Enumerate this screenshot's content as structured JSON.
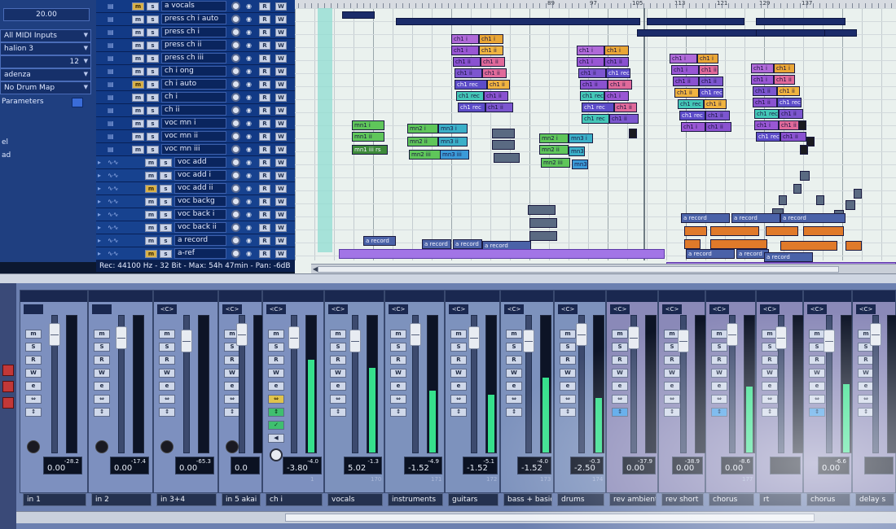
{
  "inspector": {
    "display_value": "20.00",
    "midi_input": "All MIDI Inputs",
    "channel_name": "halion 3",
    "channel_value": "12",
    "cadenza": "adenza",
    "drum_map": "No Drum Map",
    "parameters": "Parameters",
    "frag1": "el",
    "frag2": "ad"
  },
  "tracks": [
    {
      "name": "a vocals",
      "type": "midi"
    },
    {
      "name": "press ch i auto",
      "type": "midi"
    },
    {
      "name": "press ch i",
      "type": "midi"
    },
    {
      "name": "press ch ii",
      "type": "midi"
    },
    {
      "name": "press ch iii",
      "type": "midi"
    },
    {
      "name": "ch i ong",
      "type": "midi"
    },
    {
      "name": "ch i auto",
      "type": "midi"
    },
    {
      "name": "ch i",
      "type": "midi"
    },
    {
      "name": "ch ii",
      "type": "midi"
    },
    {
      "name": "voc mn i",
      "type": "midi"
    },
    {
      "name": "voc mn ii",
      "type": "midi"
    },
    {
      "name": "voc mn iii",
      "type": "midi"
    },
    {
      "name": "voc add",
      "type": "audio"
    },
    {
      "name": "voc add i",
      "type": "audio"
    },
    {
      "name": "voc add ii",
      "type": "audio"
    },
    {
      "name": "voc backg",
      "type": "audio"
    },
    {
      "name": "voc back i",
      "type": "audio"
    },
    {
      "name": "voc back ii",
      "type": "audio"
    },
    {
      "name": "a record",
      "type": "audio"
    },
    {
      "name": "a-ref",
      "type": "audio"
    }
  ],
  "track_button_labels": {
    "mute": "m",
    "solo": "s",
    "read": "R",
    "write": "W"
  },
  "status": "Rec: 44100 Hz - 32 Bit - Max: 54h 47min - Pan: -6dB",
  "ruler_ticks": [
    "89",
    "97",
    "105",
    "113",
    "121",
    "129",
    "137"
  ],
  "clips": [
    {
      "label": "ch1 i",
      "color": "#b06ad8"
    },
    {
      "label": "ch1 i",
      "color": "#e9a636"
    },
    {
      "label": "ch1 i",
      "color": "#9957d4"
    },
    {
      "label": "ch1 ii",
      "color": "#f0b440"
    },
    {
      "label": "ch1 ii",
      "color": "#8a52d0"
    },
    {
      "label": "ch1 ii",
      "color": "#e06a9a"
    },
    {
      "label": "ch1 ii",
      "color": "#7c56cf"
    },
    {
      "label": "ch1 rec",
      "color": "#44c8b8"
    },
    {
      "label": "ch1 rec",
      "color": "#5c4cc8"
    },
    {
      "label": "mn1 i",
      "color": "#5fc65a"
    },
    {
      "label": "mn1 ii",
      "color": "#5fc65a"
    },
    {
      "label": "mn1 iii rs",
      "color": "#3d8a3a"
    },
    {
      "label": "mn2 i",
      "color": "#5fc65a"
    },
    {
      "label": "mn3 i",
      "color": "#3bb0c8"
    },
    {
      "label": "mn2 ii",
      "color": "#5fc65a"
    },
    {
      "label": "mn3 ii",
      "color": "#3bb0c8"
    },
    {
      "label": "mn2 iii",
      "color": "#5fc65a"
    },
    {
      "label": "mn3 iii",
      "color": "#3b9ad8"
    },
    {
      "label": "a record",
      "color": "#4a62a8"
    },
    {
      "label": "a record",
      "color": "#4a62a8"
    },
    {
      "label": "a record",
      "color": "#4a62a8"
    }
  ],
  "mixer_channels": [
    {
      "name": "in 1",
      "pan": "",
      "volume": "0.00",
      "peak": "-28.2",
      "number": "",
      "meter": 0.0,
      "type": "input"
    },
    {
      "name": "in 2",
      "pan": "",
      "volume": "0.00",
      "peak": "-17.4",
      "number": "",
      "meter": 0.0,
      "type": "input"
    },
    {
      "name": "in 3+4",
      "pan": "<C>",
      "volume": "0.00",
      "peak": "-65.3",
      "number": "",
      "meter": 0.0,
      "type": "input"
    },
    {
      "name": "in 5 akai",
      "pan": "<C>",
      "volume": "0.0",
      "peak": "",
      "number": "",
      "meter": 0.0,
      "type": "input"
    },
    {
      "name": "ch i",
      "pan": "<C>",
      "volume": "-3.80",
      "peak": "-4.0",
      "number": "1",
      "meter": 0.68,
      "type": "midi"
    },
    {
      "name": "vocals",
      "pan": "<C>",
      "volume": "5.02",
      "peak": "-1.3",
      "number": "170",
      "meter": 0.62,
      "type": "group"
    },
    {
      "name": "instruments",
      "pan": "<C>",
      "volume": "-1.52",
      "peak": "-4.9",
      "number": "171",
      "meter": 0.45,
      "type": "group"
    },
    {
      "name": "guitars",
      "pan": "<C>",
      "volume": "-1.52",
      "peak": "-5.1",
      "number": "172",
      "meter": 0.42,
      "type": "group"
    },
    {
      "name": "bass + basics",
      "pan": "<C>",
      "volume": "-1.52",
      "peak": "-4.0",
      "number": "173",
      "meter": 0.55,
      "type": "group"
    },
    {
      "name": "drums",
      "pan": "<C>",
      "volume": "-2.50",
      "peak": "-0.3",
      "number": "174",
      "meter": 0.4,
      "type": "group"
    },
    {
      "name": "rev ambient",
      "pan": "<C>",
      "volume": "0.00",
      "peak": "-37.9",
      "number": "",
      "meter": 0.0,
      "type": "fx"
    },
    {
      "name": "rev short",
      "pan": "<C>",
      "volume": "0.00",
      "peak": "-38.9",
      "number": "",
      "meter": 0.0,
      "type": "fx"
    },
    {
      "name": "chorus",
      "pan": "<C>",
      "volume": "0.00",
      "peak": "-8.6",
      "number": "177",
      "meter": 0.48,
      "type": "fx"
    },
    {
      "name": "rt",
      "pan": "<C>",
      "volume": "",
      "peak": "",
      "number": "",
      "meter": 0.0,
      "type": "fx"
    },
    {
      "name": "chorus",
      "pan": "<C>",
      "volume": "0.00",
      "peak": "-6.6",
      "number": "",
      "meter": 0.5,
      "type": "fx"
    },
    {
      "name": "delay s",
      "pan": "<C>",
      "volume": "",
      "peak": "",
      "number": "",
      "meter": 0.0,
      "type": "fx"
    }
  ],
  "mixer_button_labels": {
    "mute": "m",
    "solo": "S",
    "read": "R",
    "write": "W",
    "edit": "e"
  },
  "colors": {
    "accent": "#36e08c",
    "track_bg": "#123a86",
    "arrange_bg": "#eaf1ee"
  }
}
